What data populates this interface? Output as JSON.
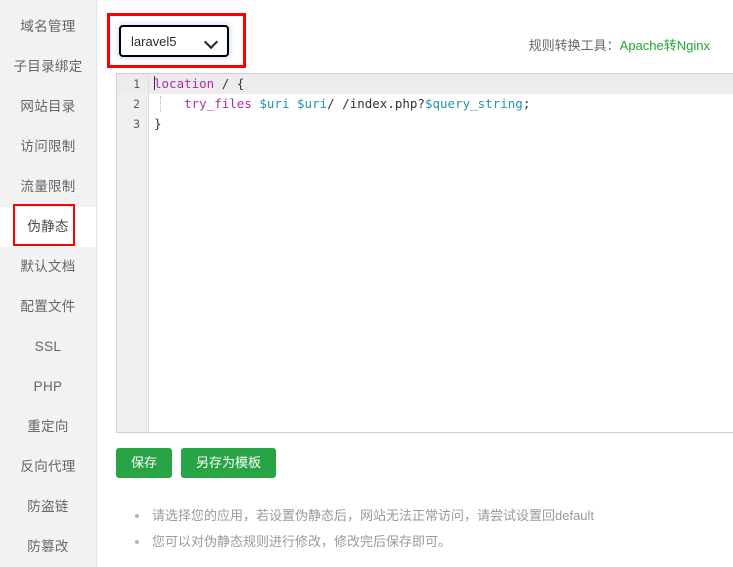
{
  "sidebar": {
    "items": [
      {
        "label": "域名管理",
        "active": false
      },
      {
        "label": "子目录绑定",
        "active": false
      },
      {
        "label": "网站目录",
        "active": false
      },
      {
        "label": "访问限制",
        "active": false
      },
      {
        "label": "流量限制",
        "active": false
      },
      {
        "label": "伪静态",
        "active": true
      },
      {
        "label": "默认文档",
        "active": false
      },
      {
        "label": "配置文件",
        "active": false
      },
      {
        "label": "SSL",
        "active": false
      },
      {
        "label": "PHP",
        "active": false
      },
      {
        "label": "重定向",
        "active": false
      },
      {
        "label": "反向代理",
        "active": false
      },
      {
        "label": "防盗链",
        "active": false
      },
      {
        "label": "防篡改",
        "active": false
      }
    ]
  },
  "toolbar": {
    "select": {
      "value": "laravel5",
      "chevron_icon": "chevron-down-icon"
    },
    "converter_label": "规则转换工具：",
    "converter_link": "Apache转Nginx"
  },
  "editor": {
    "lines": [
      {
        "number": "1",
        "text": "location / {"
      },
      {
        "number": "2",
        "text": "    try_files $uri $uri/ /index.php?$query_string;"
      },
      {
        "number": "3",
        "text": "}"
      }
    ]
  },
  "buttons": {
    "save_label": "保存",
    "save_as_template_label": "另存为模板"
  },
  "notes": [
    "请选择您的应用，若设置伪静态后，网站无法正常访问，请尝试设置回default",
    "您可以对伪静态规则进行修改，修改完后保存即可。"
  ],
  "colors": {
    "accent_green": "#28a445",
    "link_green": "#20a53a",
    "annotation_red": "#ff0000",
    "code_keyword": "#b32ba8",
    "code_variable": "#2196a8",
    "sidebar_bg": "#f2f2f2"
  }
}
